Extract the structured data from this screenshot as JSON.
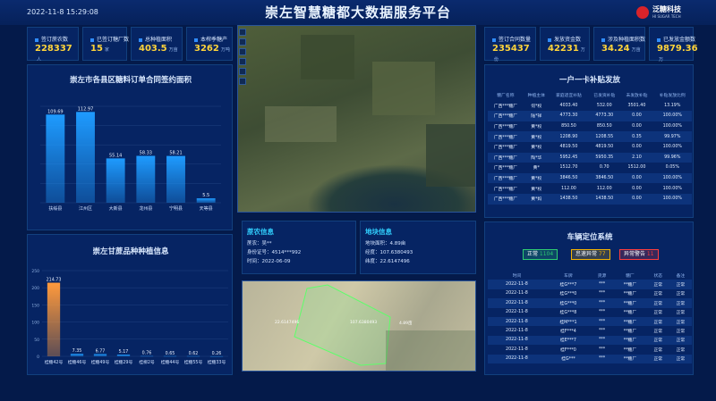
{
  "header": {
    "title": "崇左智慧糖都大数据服务平台",
    "datetime": "2022-11-8 15:29:08",
    "logo_name": "泛糖科技",
    "logo_sub": "HI SUGAR TECH",
    "logo_color": "#d8232a"
  },
  "left_stats": [
    {
      "label": "签订蔗农数",
      "value": "228337",
      "unit": "人"
    },
    {
      "label": "已签订糖厂数",
      "value": "15",
      "unit": "家"
    },
    {
      "label": "总种植面积",
      "value": "403.5",
      "unit": "万亩"
    },
    {
      "label": "本榨季糖产",
      "value": "3262",
      "unit": "万吨"
    }
  ],
  "right_stats": [
    {
      "label": "签订合同数量",
      "value": "235437",
      "unit": "份"
    },
    {
      "label": "发放资金数",
      "value": "42231",
      "unit": "万"
    },
    {
      "label": "涉及种植面积数",
      "value": "34.24",
      "unit": "万亩"
    },
    {
      "label": "已发放金额数",
      "value": "9879.36",
      "unit": "万"
    }
  ],
  "chart1": {
    "title": "崇左市各县区糖料订单合同签约面积"
  },
  "chart2": {
    "title": "崇左甘蔗品种种植信息"
  },
  "chart_data": [
    {
      "type": "bar",
      "title": "崇左市各县区糖料订单合同签约面积",
      "categories": [
        "扶绥县",
        "江州区",
        "大新县",
        "龙州县",
        "宁明县",
        "天等县"
      ],
      "values": [
        109.69,
        112.97,
        55.14,
        58.33,
        58.21,
        5.5
      ],
      "ylim": [
        0,
        120
      ],
      "color": "#1e9bff"
    },
    {
      "type": "bar",
      "title": "崇左甘蔗品种种植信息",
      "categories": [
        "桂糖42号",
        "桂糖46号",
        "桂糖49号",
        "桂糖29号",
        "桂柳2号",
        "桂糖44号",
        "桂糖55号",
        "桂糖33号"
      ],
      "values": [
        214.73,
        7.35,
        6.77,
        5.17,
        0.76,
        0.65,
        0.62,
        0.26
      ],
      "ylim": [
        0,
        250
      ],
      "yticks": [
        "250",
        "200",
        "150",
        "100",
        "50",
        "0"
      ],
      "highlight": "#ff9a3c",
      "color": "#1e9bff"
    }
  ],
  "subsidy": {
    "title": "一户一卡补贴发放",
    "headers": [
      "糖厂名称",
      "种植主体",
      "家庭适宜补贴",
      "已发资补贴",
      "未发放补贴",
      "补贴发放比例"
    ],
    "rows": [
      [
        "广西***糖厂",
        "何*权",
        "4033.40",
        "532.00",
        "3501.40",
        "13.19%"
      ],
      [
        "广西***糖厂",
        "陆*祥",
        "4773.30",
        "4773.30",
        "0.00",
        "100.00%"
      ],
      [
        "广西***糖厂",
        "黄*权",
        "850.50",
        "850.50",
        "0.00",
        "100.00%"
      ],
      [
        "广西***糖厂",
        "黄*权",
        "1208.90",
        "1208.55",
        "0.35",
        "99.97%"
      ],
      [
        "广西***糖厂",
        "黄*权",
        "4819.50",
        "4819.50",
        "0.00",
        "100.00%"
      ],
      [
        "广西***糖厂",
        "陶*华",
        "5952.45",
        "5950.35",
        "2.10",
        "99.96%"
      ],
      [
        "广西***糖厂",
        "黄*",
        "1512.70",
        "0.70",
        "1512.00",
        "0.05%"
      ],
      [
        "广西***糖厂",
        "黄*权",
        "3846.50",
        "3846.50",
        "0.00",
        "100.00%"
      ],
      [
        "广西***糖厂",
        "黄*权",
        "112.00",
        "112.00",
        "0.00",
        "100.00%"
      ],
      [
        "广西***糖厂",
        "黄*妈",
        "1438.50",
        "1438.50",
        "0.00",
        "100.00%"
      ]
    ]
  },
  "farmer": {
    "title": "蔗农信息",
    "name_label": "蔗农：",
    "name": "吴**",
    "id_label": "身份证号：",
    "id": "4514***992",
    "time_label": "时间：",
    "time": "2022-06-09"
  },
  "plot": {
    "title": "地块信息",
    "area_label": "地块面积：",
    "area": "4.89亩",
    "lng_label": "经度：",
    "lng": "107.6380493",
    "lat_label": "纬度：",
    "lat": "22.6147496"
  },
  "map_overlay": {
    "label_a": "22.6147496",
    "label_b": "107.6380493",
    "label_c": "4.89亩"
  },
  "vehicles": {
    "title": "车辆定位系统",
    "badges": [
      {
        "label": "正常",
        "count": "1104",
        "color": "#2ecc71"
      },
      {
        "label": "怠速异常",
        "count": "77",
        "color": "#f5b400"
      },
      {
        "label": "异常警告",
        "count": "11",
        "color": "#ff3d3d"
      }
    ],
    "headers": [
      "时间",
      "车牌",
      "货源",
      "糖厂",
      "状态",
      "备注"
    ],
    "rows": [
      [
        "2022-11-8",
        "桂G***7",
        "***",
        "**糖厂",
        "正常",
        "正常"
      ],
      [
        "2022-11-8",
        "桂G***0",
        "***",
        "**糖厂",
        "正常",
        "正常"
      ],
      [
        "2022-11-8",
        "桂G***0",
        "***",
        "**糖厂",
        "正常",
        "正常"
      ],
      [
        "2022-11-8",
        "桂G***8",
        "***",
        "**糖厂",
        "正常",
        "正常"
      ],
      [
        "2022-11-8",
        "桂M***1",
        "***",
        "**糖厂",
        "正常",
        "正常"
      ],
      [
        "2022-11-8",
        "桂F***4",
        "***",
        "**糖厂",
        "正常",
        "正常"
      ],
      [
        "2022-11-8",
        "桂E***7",
        "***",
        "**糖厂",
        "正常",
        "正常"
      ],
      [
        "2022-11-8",
        "桂F***0",
        "***",
        "**糖厂",
        "正常",
        "正常"
      ],
      [
        "2022-11-8",
        "桂G***",
        "***",
        "**糖厂",
        "正常",
        "正常"
      ]
    ]
  }
}
